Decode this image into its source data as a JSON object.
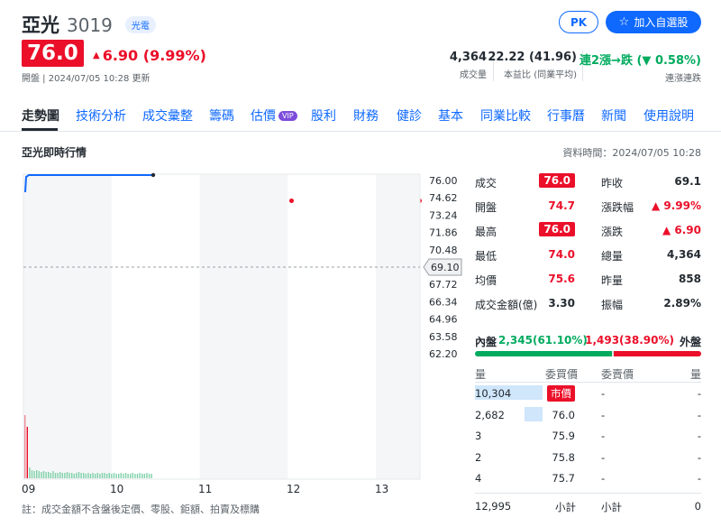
{
  "stock": {
    "name": "亞光",
    "code": "3019",
    "sector": "光電",
    "price": "76.0",
    "change": "6.90 (9.99%)",
    "meta": "開盤 | 2024/07/05 10:28 更新"
  },
  "actions": {
    "pk_label": "PK",
    "watchlist_label": "加入自選股"
  },
  "stats": [
    {
      "value": "4,364",
      "label": "成交量"
    },
    {
      "value": "22.22 (41.96)",
      "label": "本益比 (同業平均)"
    },
    {
      "value": "連2漲→跌 (▼ 0.58%)",
      "label": "連漲連跌"
    }
  ],
  "tabs": [
    "走勢圖",
    "技術分析",
    "成交彙整",
    "籌碼",
    "估價",
    "股利",
    "財務",
    "健診",
    "基本",
    "同業比較",
    "行事曆",
    "新聞",
    "使用說明"
  ],
  "vip_label": "VIP",
  "section": {
    "title": "亞光即時行情",
    "data_time": "資料時間：2024/07/05 10:28"
  },
  "chart_data": {
    "type": "line",
    "x_ticks": [
      "09",
      "10",
      "11",
      "12",
      "13"
    ],
    "y_ticks": [
      "76.00",
      "74.62",
      "73.24",
      "71.86",
      "70.48",
      "69.10",
      "67.72",
      "66.34",
      "64.96",
      "63.58",
      "62.20"
    ],
    "ylim": [
      62.2,
      76.0
    ],
    "reference_price": "69.10",
    "price_series": [
      {
        "t": "09:00",
        "p": 74.7
      },
      {
        "t": "09:01",
        "p": 76.0
      },
      {
        "t": "10:28",
        "p": 76.0
      }
    ],
    "volume_note": "volume bars shown at bottom of chart"
  },
  "footnote": "註：成交金額不含盤後定價、零股、鉅額、拍賣及標購",
  "quote": {
    "rows": [
      {
        "l1": "成交",
        "v1": "76.0",
        "t1": "tag",
        "l2": "昨收",
        "v2": "69.1",
        "t2": ""
      },
      {
        "l1": "開盤",
        "v1": "74.7",
        "t1": "red",
        "l2": "漲跌幅",
        "v2": "▲ 9.99%",
        "t2": "red"
      },
      {
        "l1": "最高",
        "v1": "76.0",
        "t1": "tag",
        "l2": "漲跌",
        "v2": "▲ 6.90",
        "t2": "red"
      },
      {
        "l1": "最低",
        "v1": "74.0",
        "t1": "red",
        "l2": "總量",
        "v2": "4,364",
        "t2": ""
      },
      {
        "l1": "均價",
        "v1": "75.6",
        "t1": "red",
        "l2": "昨量",
        "v2": "858",
        "t2": ""
      },
      {
        "l1": "成交金額(億)",
        "v1": "3.30",
        "t1": "",
        "l2": "振幅",
        "v2": "2.89%",
        "t2": ""
      }
    ]
  },
  "pressure": {
    "inner_label": "內盤",
    "inner_value": "2,345(61.10%)",
    "outer_value": "1,493(38.90%)",
    "outer_label": "外盤",
    "inner_pct": 61.1
  },
  "book": {
    "headers": [
      "量",
      "委買價",
      "委賣價",
      "量"
    ],
    "rows": [
      {
        "bid_qty": "10,304",
        "bid_price": "市價",
        "ask_price": "-",
        "ask_qty": "-"
      },
      {
        "bid_qty": "2,682",
        "bid_price": "76.0",
        "ask_price": "-",
        "ask_qty": "-"
      },
      {
        "bid_qty": "3",
        "bid_price": "75.9",
        "ask_price": "-",
        "ask_qty": "-"
      },
      {
        "bid_qty": "2",
        "bid_price": "75.8",
        "ask_price": "-",
        "ask_qty": "-"
      },
      {
        "bid_qty": "4",
        "bid_price": "75.7",
        "ask_price": "-",
        "ask_qty": "-"
      }
    ],
    "total": {
      "bid_qty": "12,995",
      "bid_label": "小計",
      "ask_label": "小計",
      "ask_qty": "0"
    }
  }
}
